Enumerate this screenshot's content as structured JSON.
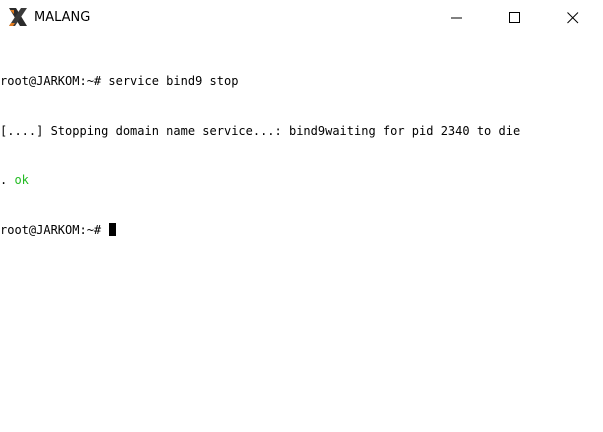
{
  "window": {
    "title": "MALANG",
    "icon": "xlaunch-x-icon",
    "controls": [
      "minimize-icon",
      "maximize-icon",
      "close-icon"
    ]
  },
  "terminal": {
    "lines": [
      "root@JARKOM:~# service bind9 stop",
      "[....] Stopping domain name service...: bind9waiting for pid 2340 to die",
      ". "
    ],
    "ok_text": "ok",
    "prompt": "root@JARKOM:~# ",
    "ok_color": "#22bb22",
    "text_color": "#000000",
    "background": "#ffffff"
  }
}
